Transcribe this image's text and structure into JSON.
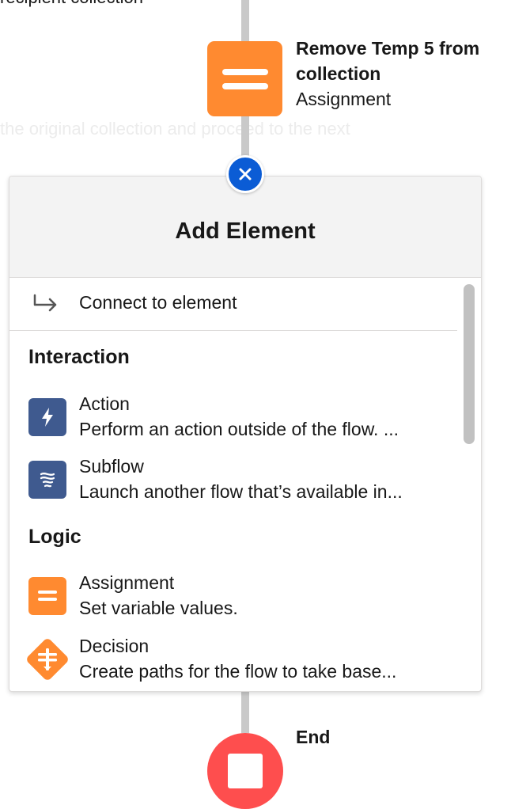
{
  "canvas": {
    "previous_element_label": "recipient collection",
    "faded_label": "the original collection and proceed to the next"
  },
  "assignment_node": {
    "title": "Remove Temp 5 from collection",
    "type_label": "Assignment",
    "color": "#ff8a30",
    "icon": "assignment-icon"
  },
  "add_element_panel": {
    "close_icon": "close-icon",
    "close_button_color": "#0b5cd5",
    "title": "Add Element",
    "connect": {
      "label": "Connect to element",
      "icon": "connect-arrow-icon"
    },
    "sections": [
      {
        "title": "Interaction",
        "items": [
          {
            "title": "Action",
            "description": "Perform an action outside of the flow. ...",
            "icon": "lightning-icon",
            "color": "#3f5a8f"
          },
          {
            "title": "Subflow",
            "description": "Launch another flow that’s available in...",
            "icon": "subflow-icon",
            "color": "#3f5a8f"
          }
        ]
      },
      {
        "title": "Logic",
        "items": [
          {
            "title": "Assignment",
            "description": "Set variable values.",
            "icon": "assignment-icon",
            "color": "#ff8a30"
          },
          {
            "title": "Decision",
            "description": "Create paths for the flow to take base...",
            "icon": "decision-icon",
            "color": "#ff8a30"
          }
        ]
      }
    ]
  },
  "end_node": {
    "label": "End",
    "color": "#fe4e4e",
    "icon": "stop-icon"
  }
}
